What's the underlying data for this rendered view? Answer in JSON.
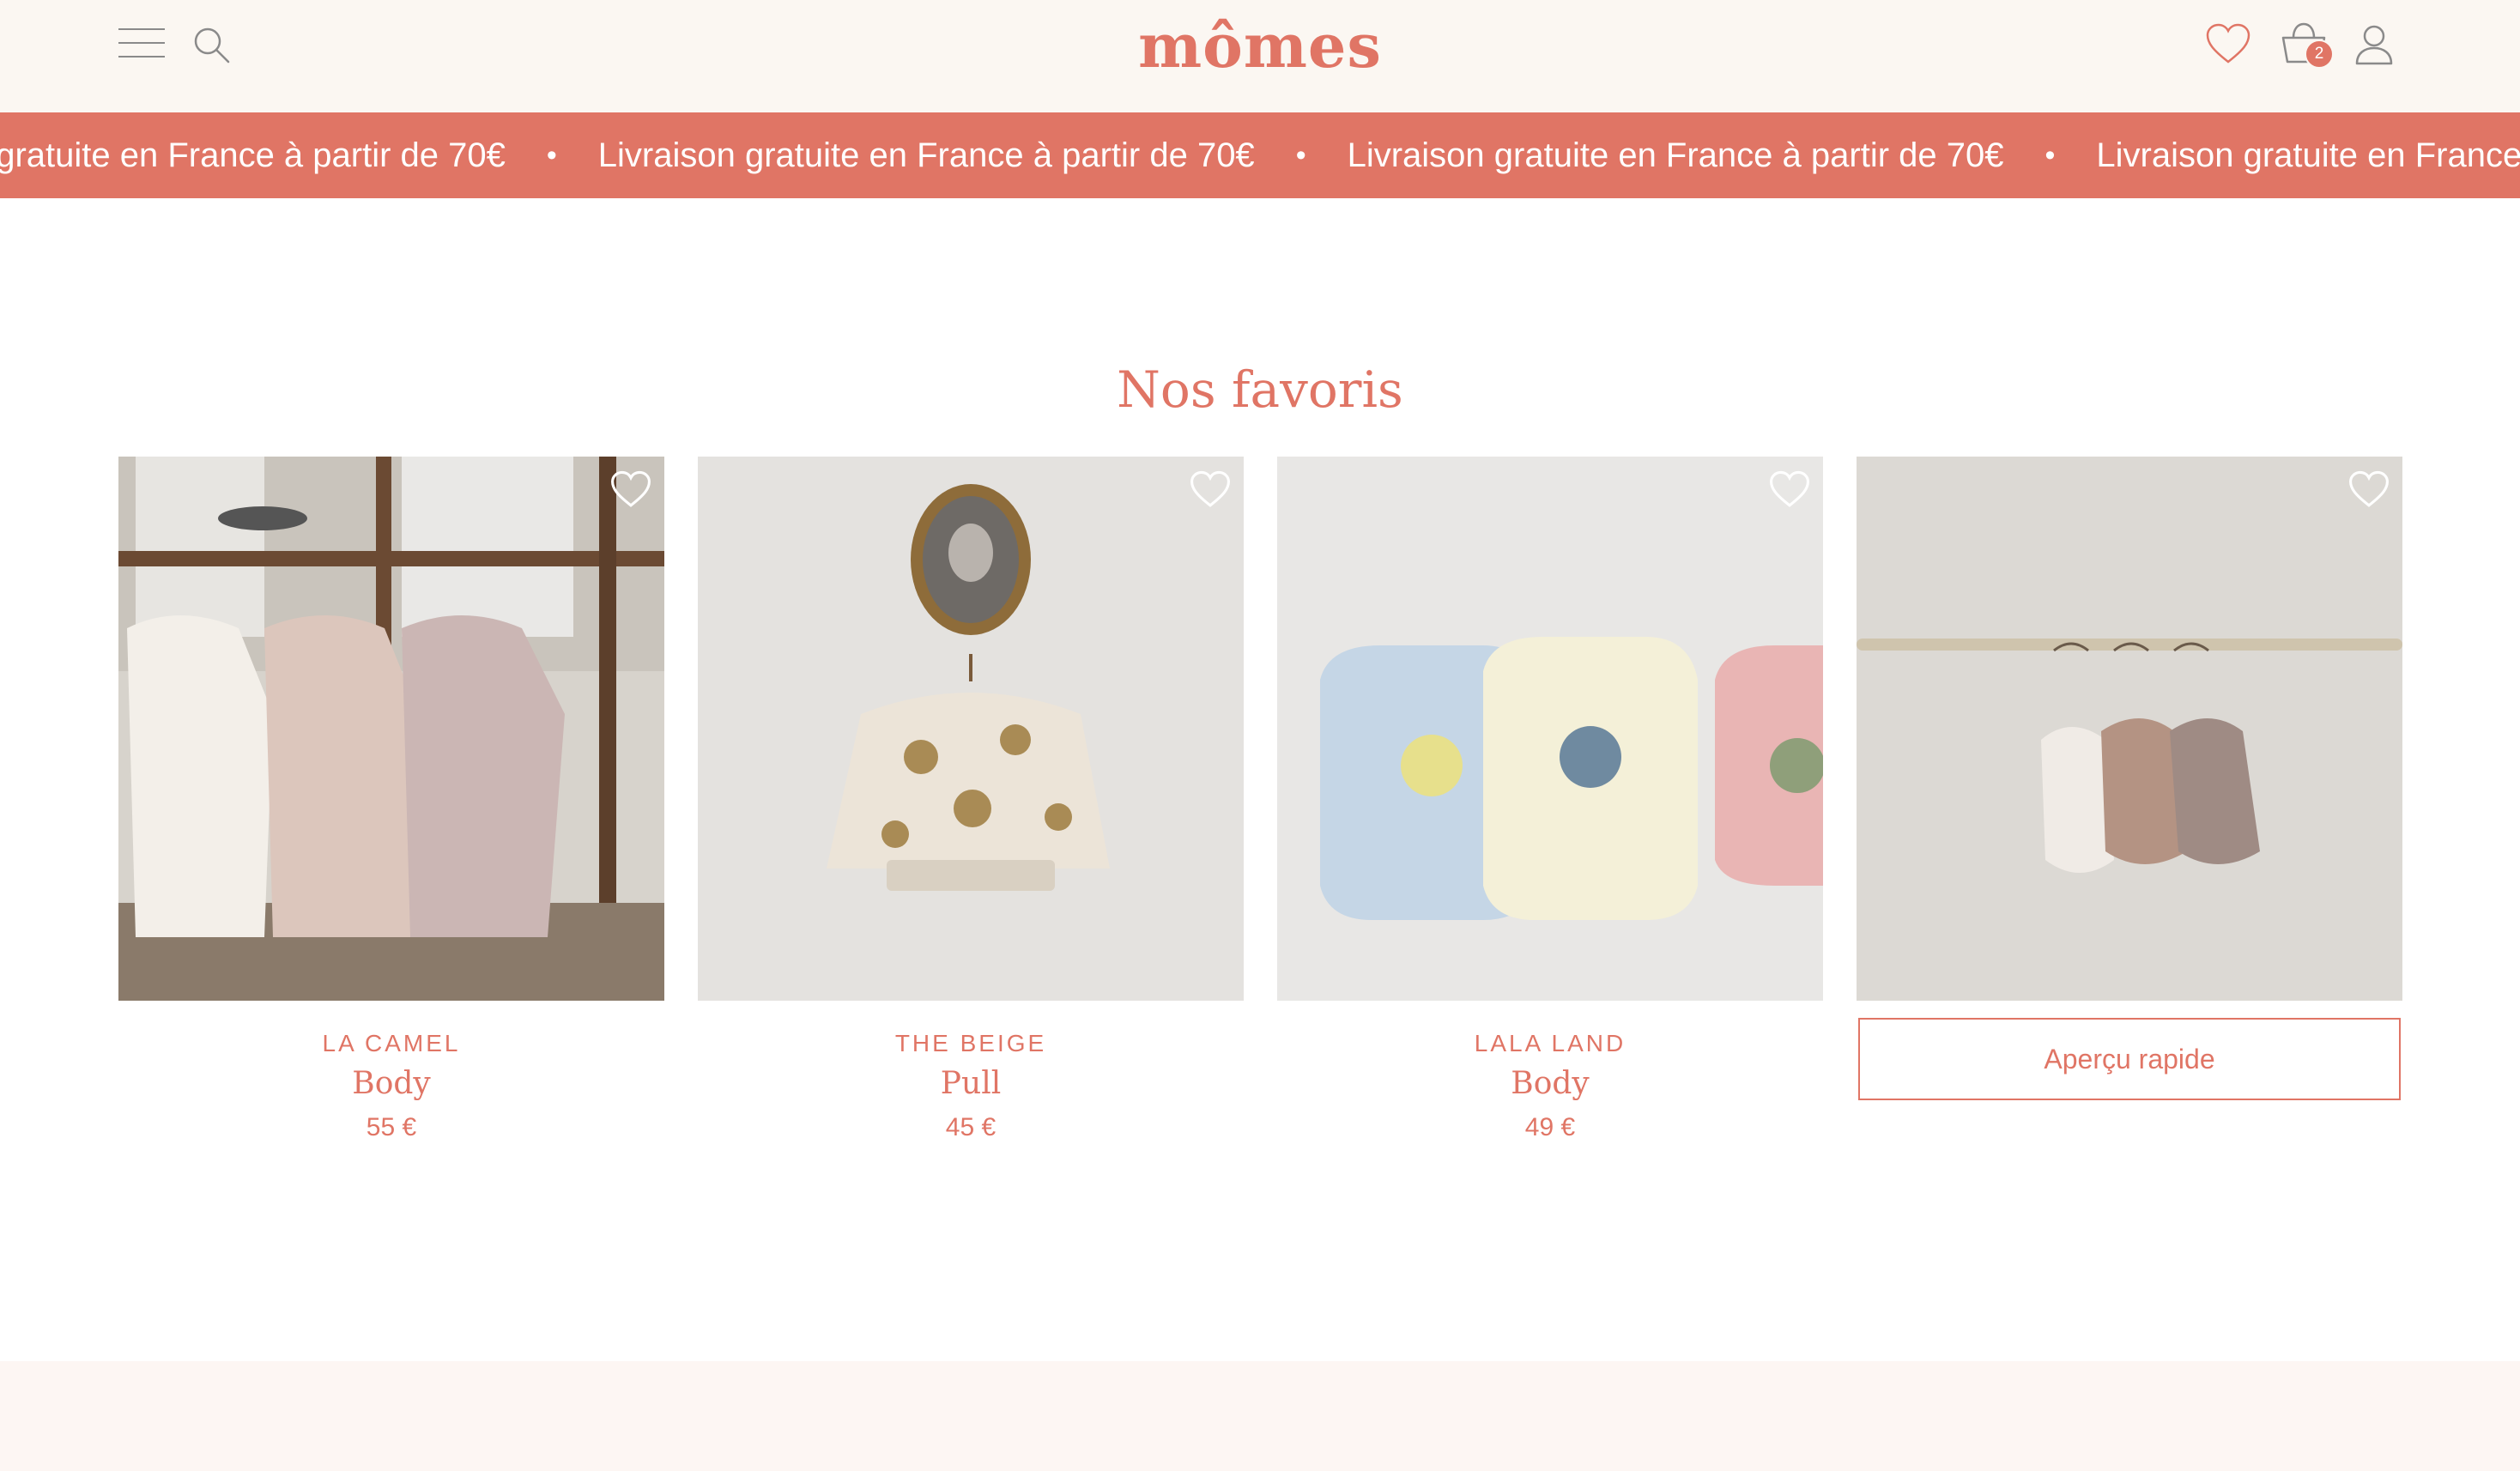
{
  "header": {
    "logo": "mômes",
    "cart_count": "2",
    "icons": [
      "menu-icon",
      "search-icon",
      "heart-icon",
      "cart-icon",
      "user-icon"
    ]
  },
  "banner": {
    "text": "Livraison gratuite en France à partir de 70€",
    "separator": "•"
  },
  "section": {
    "title": "Nos favoris"
  },
  "products": [
    {
      "brand": "LA CAMEL",
      "name": "Body",
      "price": "55 €"
    },
    {
      "brand": "THE BEIGE",
      "name": "Pull",
      "price": "45 €"
    },
    {
      "brand": "LALA LAND",
      "name": "Body",
      "price": "49 €"
    },
    {
      "quick_view": "Aperçu rapide"
    }
  ],
  "colors": {
    "accent": "#e07565",
    "header_bg": "#fbf7f2",
    "footer_bg": "#fdf6f3"
  }
}
